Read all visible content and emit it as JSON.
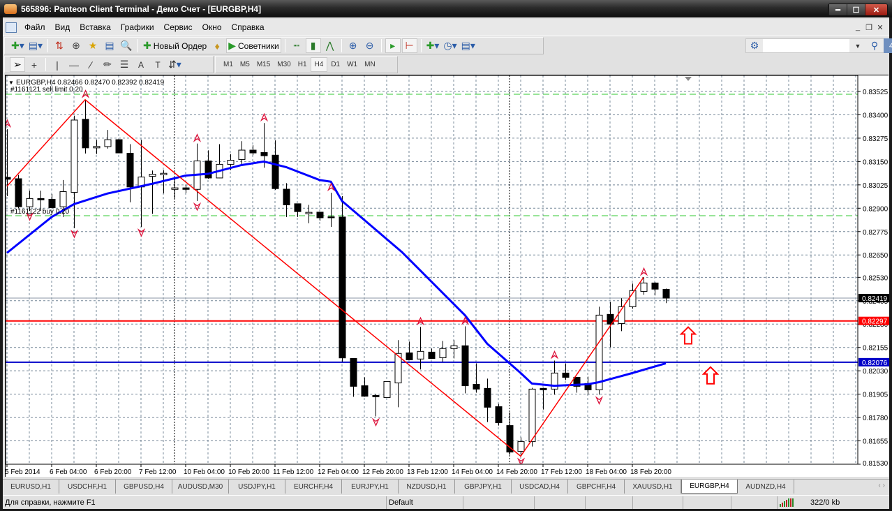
{
  "window": {
    "title": "565896: Panteon Client Terminal - Демо Счет - [EURGBP,H4]",
    "buttons": [
      "minimize",
      "maximize",
      "close"
    ]
  },
  "menu": [
    "Файл",
    "Вид",
    "Вставка",
    "Графики",
    "Сервис",
    "Окно",
    "Справка"
  ],
  "toolbar": {
    "new_order": "Новый Ордер",
    "experts": "Советники",
    "search_placeholder": "",
    "notifications": "4"
  },
  "timeframes": [
    "M1",
    "M5",
    "M15",
    "M30",
    "H1",
    "H4",
    "D1",
    "W1",
    "MN"
  ],
  "active_timeframe": "H4",
  "chart": {
    "header": "EURGBP,H4  0.82466 0.82470 0.82392 0.82419",
    "order_sell": "#1161121 sell limit 0.20",
    "order_buy": "#1161122 buy 0.20",
    "colors": {
      "bull": "#ffffff",
      "bear": "#000000",
      "ma": "#0000ff",
      "zigzag": "#ff0000",
      "grid": "#778899",
      "order": "#32c832",
      "hline_red": "#ff0000",
      "hline_blue": "#0000c8"
    }
  },
  "chart_data": {
    "type": "candlestick",
    "symbol": "EURGBP",
    "timeframe": "H4",
    "ylim": [
      0.8153,
      0.83525
    ],
    "y_ticks": [
      "0.83525",
      "0.83400",
      "0.83275",
      "0.83150",
      "0.83025",
      "0.82900",
      "0.82775",
      "0.82650",
      "0.82530",
      "0.82405",
      "0.82280",
      "0.82155",
      "0.82030",
      "0.81905",
      "0.81780",
      "0.81655",
      "0.81530"
    ],
    "time_labels": [
      "5 Feb 2014",
      "6 Feb 04:00",
      "6 Feb 20:00",
      "7 Feb 12:00",
      "10 Feb 04:00",
      "10 Feb 20:00",
      "11 Feb 12:00",
      "12 Feb 04:00",
      "12 Feb 20:00",
      "13 Feb 12:00",
      "14 Feb 04:00",
      "14 Feb 20:00",
      "17 Feb 12:00",
      "18 Feb 04:00",
      "18 Feb 20:00"
    ],
    "candles": [
      [
        0.83065,
        0.83323,
        0.82965,
        0.83055
      ],
      [
        0.83058,
        0.83078,
        0.82899,
        0.82908
      ],
      [
        0.82908,
        0.82994,
        0.82886,
        0.82952
      ],
      [
        0.82952,
        0.82994,
        0.82886,
        0.82945
      ],
      [
        0.82948,
        0.82976,
        0.82899,
        0.82903
      ],
      [
        0.82908,
        0.83051,
        0.82853,
        0.82989
      ],
      [
        0.82985,
        0.83395,
        0.82793,
        0.83372
      ],
      [
        0.83376,
        0.83481,
        0.83193,
        0.83223
      ],
      [
        0.83223,
        0.83266,
        0.8319,
        0.83231
      ],
      [
        0.8323,
        0.83319,
        0.83219,
        0.83267
      ],
      [
        0.83267,
        0.8327,
        0.83196,
        0.83196
      ],
      [
        0.83194,
        0.83243,
        0.82932,
        0.83014
      ],
      [
        0.83014,
        0.83266,
        0.828,
        0.83067
      ],
      [
        0.83071,
        0.83102,
        0.8287,
        0.83082
      ],
      [
        0.83079,
        0.83104,
        0.82979,
        0.83087
      ],
      [
        0.83001,
        0.83065,
        0.82952,
        0.83009
      ],
      [
        0.83009,
        0.83025,
        0.82981,
        0.83001
      ],
      [
        0.83001,
        0.83246,
        0.82939,
        0.83153
      ],
      [
        0.83153,
        0.8321,
        0.83058,
        0.83062
      ],
      [
        0.83062,
        0.83243,
        0.83061,
        0.83135
      ],
      [
        0.83135,
        0.8319,
        0.83104,
        0.83157
      ],
      [
        0.83161,
        0.83259,
        0.83131,
        0.83211
      ],
      [
        0.83211,
        0.83237,
        0.83184,
        0.83196
      ],
      [
        0.83198,
        0.83356,
        0.83117,
        0.83181
      ],
      [
        0.83184,
        0.83263,
        0.82998,
        0.83005
      ],
      [
        0.83002,
        0.83034,
        0.82853,
        0.82918
      ],
      [
        0.82924,
        0.82924,
        0.82853,
        0.82882
      ],
      [
        0.82871,
        0.82918,
        0.8282,
        0.82878
      ],
      [
        0.82879,
        0.82879,
        0.82833,
        0.82849
      ],
      [
        0.82854,
        0.82983,
        0.828,
        0.82849
      ],
      [
        0.82853,
        0.82965,
        0.82079,
        0.82099
      ],
      [
        0.82096,
        0.82096,
        0.81891,
        0.81947
      ],
      [
        0.8195,
        0.81995,
        0.81891,
        0.81894
      ],
      [
        0.81898,
        0.81906,
        0.81786,
        0.81891
      ],
      [
        0.81887,
        0.81973,
        0.81887,
        0.81973
      ],
      [
        0.81965,
        0.82194,
        0.81835,
        0.82123
      ],
      [
        0.82126,
        0.82186,
        0.82089,
        0.82089
      ],
      [
        0.82093,
        0.82265,
        0.82037,
        0.82134
      ],
      [
        0.8213,
        0.82149,
        0.82093,
        0.82096
      ],
      [
        0.821,
        0.8219,
        0.82078,
        0.82149
      ],
      [
        0.82149,
        0.82194,
        0.82096,
        0.82164
      ],
      [
        0.82164,
        0.82268,
        0.81909,
        0.8195
      ],
      [
        0.81958,
        0.8207,
        0.81913,
        0.81932
      ],
      [
        0.81936,
        0.81988,
        0.81756,
        0.81835
      ],
      [
        0.81838,
        0.81853,
        0.81737,
        0.81752
      ],
      [
        0.81737,
        0.81808,
        0.8158,
        0.81595
      ],
      [
        0.81599,
        0.81674,
        0.81573,
        0.81651
      ],
      [
        0.81651,
        0.81939,
        0.81625,
        0.81932
      ],
      [
        0.81936,
        0.81939,
        0.81823,
        0.81928
      ],
      [
        0.81932,
        0.82085,
        0.81902,
        0.82018
      ],
      [
        0.82018,
        0.8207,
        0.8198,
        0.81995
      ],
      [
        0.81995,
        0.81995,
        0.81913,
        0.81947
      ],
      [
        0.81962,
        0.81999,
        0.81902,
        0.81928
      ],
      [
        0.81928,
        0.82373,
        0.81902,
        0.82328
      ],
      [
        0.82332,
        0.82399,
        0.82156,
        0.8228
      ],
      [
        0.82283,
        0.82418,
        0.82242,
        0.82373
      ],
      [
        0.82373,
        0.82497,
        0.82362,
        0.82459
      ],
      [
        0.82455,
        0.8253,
        0.82437,
        0.825
      ],
      [
        0.825,
        0.82504,
        0.82433,
        0.82467
      ],
      [
        0.82466,
        0.8247,
        0.82392,
        0.82419
      ]
    ],
    "candle_format": [
      "open",
      "high",
      "low",
      "close"
    ],
    "moving_average": [
      [
        0,
        0.82661
      ],
      [
        4,
        0.82853
      ],
      [
        6,
        0.82922
      ],
      [
        9,
        0.82979
      ],
      [
        13,
        0.83031
      ],
      [
        16,
        0.83075
      ],
      [
        18,
        0.83084
      ],
      [
        21,
        0.83131
      ],
      [
        23,
        0.8315
      ],
      [
        25,
        0.8312
      ],
      [
        28,
        0.83051
      ],
      [
        29,
        0.83042
      ],
      [
        30,
        0.82939
      ],
      [
        35.375,
        0.82665
      ],
      [
        41,
        0.82328
      ],
      [
        43,
        0.82175
      ],
      [
        46,
        0.82018
      ],
      [
        47,
        0.81962
      ],
      [
        49,
        0.8195
      ],
      [
        52,
        0.81958
      ],
      [
        53,
        0.81969
      ],
      [
        56,
        0.82018
      ],
      [
        59,
        0.8207
      ]
    ],
    "zigzag": [
      [
        0,
        0.83018
      ],
      [
        7,
        0.83481
      ],
      [
        46,
        0.81573
      ],
      [
        57,
        0.8253
      ]
    ],
    "fractals_up": [
      0,
      7,
      17,
      23,
      29,
      37,
      41,
      49,
      57
    ],
    "fractals_down": [
      2,
      6,
      12,
      17,
      33,
      46,
      53
    ],
    "period_separators": [
      15,
      45
    ],
    "hlines": [
      {
        "price": 0.82297,
        "label": "0.82297",
        "color": "#ff0000"
      },
      {
        "price": 0.82076,
        "label": "0.82076",
        "color": "#0000c8"
      }
    ],
    "current_price": {
      "price": 0.82419,
      "label": "0.82419"
    },
    "orders": [
      {
        "price": 0.8351
      },
      {
        "price": 0.8286
      }
    ],
    "arrow_objects": [
      {
        "candle": 61,
        "price": 0.82264
      },
      {
        "candle": 63,
        "price": 0.8205
      }
    ]
  },
  "tabs": [
    "EURUSD,H1",
    "USDCHF,H1",
    "GBPUSD,H4",
    "AUDUSD,M30",
    "USDJPY,H1",
    "EURCHF,H4",
    "EURJPY,H1",
    "NZDUSD,H1",
    "GBPJPY,H1",
    "USDCAD,H4",
    "GBPCHF,H4",
    "XAUUSD,H1",
    "EURGBP,H4",
    "AUDNZD,H4"
  ],
  "active_tab": "EURGBP,H4",
  "status": {
    "help": "Для справки, нажмите F1",
    "profile": "Default",
    "traffic": "322/0 kb"
  }
}
